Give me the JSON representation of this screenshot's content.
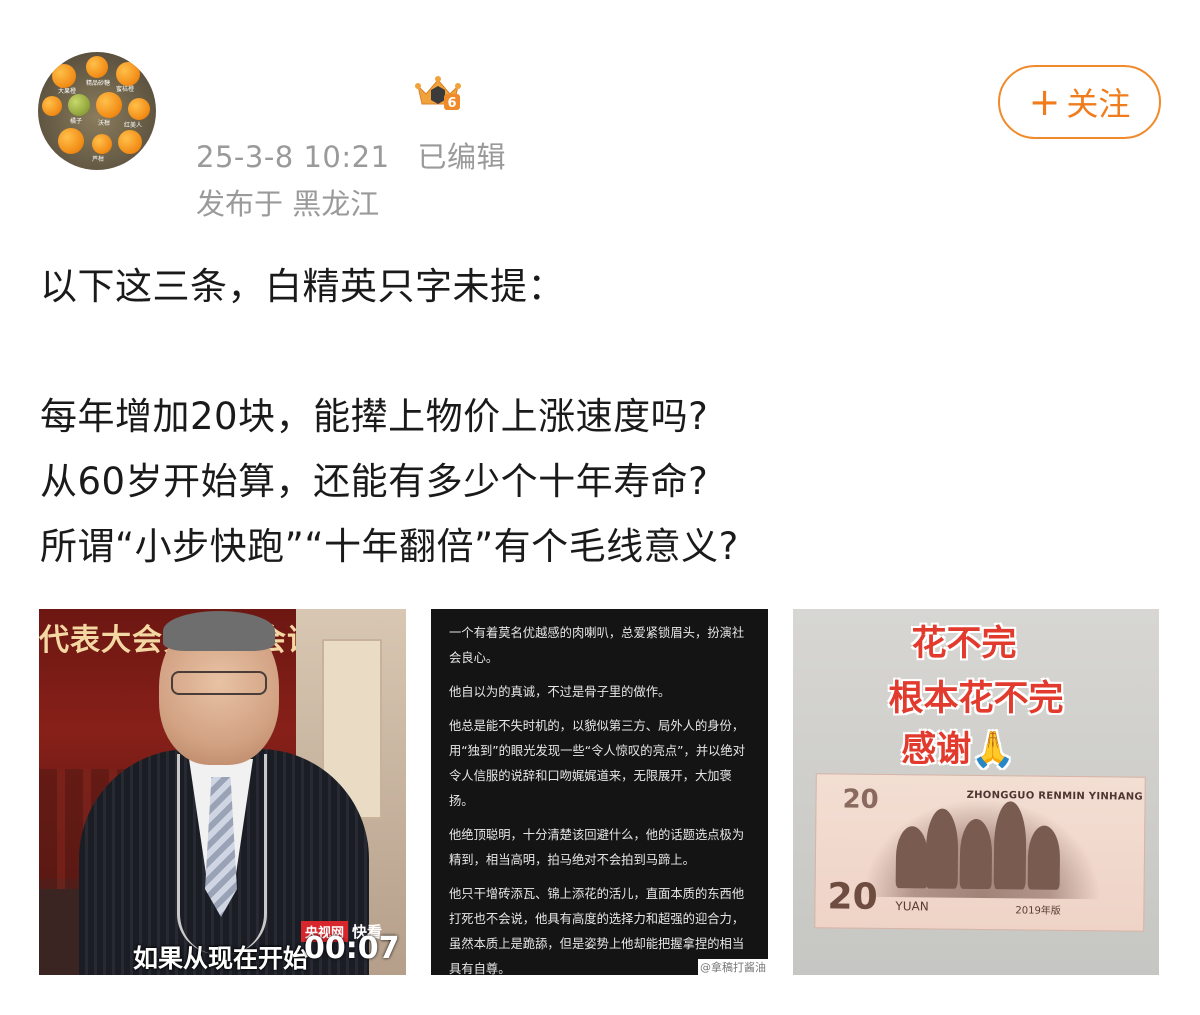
{
  "post": {
    "timestamp": "25-3-8 10:21",
    "edited_label": "已编辑",
    "location": "发布于 黑龙江",
    "follow_plus": "+",
    "follow_label": "关注",
    "lines": [
      "以下这三条，白精英只字未提：",
      "每年增加20块，能撵上物价上涨速度吗?",
      "从60岁开始算，还能有多少个十年寿命?",
      "所谓“小步快跑”“十年翻倍”有个毛线意义?"
    ],
    "badge_number": "6"
  },
  "avatar": {
    "labels": [
      "大果橙",
      "精品砂糖",
      "蜜桔橙",
      "沃柑",
      "橘子",
      "沃柑",
      "红美人",
      "芦柑"
    ]
  },
  "images": {
    "video": {
      "banner": "代表大会第三次会议",
      "source_logo": "央视网",
      "source_tag": "快看",
      "subtitle": "如果从现在开始",
      "time": "00:07"
    },
    "text_image": {
      "paragraphs": [
        "一个有着莫名优越感的肉喇叭，总爱紧锁眉头，扮演社会良心。",
        "他自以为的真诚，不过是骨子里的做作。",
        "他总是能不失时机的，以貌似第三方、局外人的身份，用“独到”的眼光发现一些“令人惊叹的亮点”，并以绝对令人信服的说辞和口吻娓娓道来，无限展开，大加褒扬。",
        "他绝顶聪明，十分清楚该回避什么，他的话题选点极为精到，相当高明，拍马绝对不会拍到马蹄上。",
        "他只干增砖添瓦、锦上添花的活儿，直面本质的东西他打死也不会说，他具有高度的选择力和超强的迎合力，虽然本质上是跪舔，但是姿势上他却能把握拿捏的相当具有自尊。"
      ],
      "watermark": "@拿稿打酱油"
    },
    "banknote": {
      "caption_1": "花不完",
      "caption_2": "根本花不完",
      "caption_3": "感谢🙏",
      "bank_text": "ZHONGGUO RENMIN YINHANG",
      "denomination": "20",
      "currency": "YUAN",
      "year": "2019年版"
    }
  },
  "colors": {
    "accent": "#f07c1b",
    "meta_gray": "#9a9a9a",
    "text": "#1a1a1a"
  }
}
